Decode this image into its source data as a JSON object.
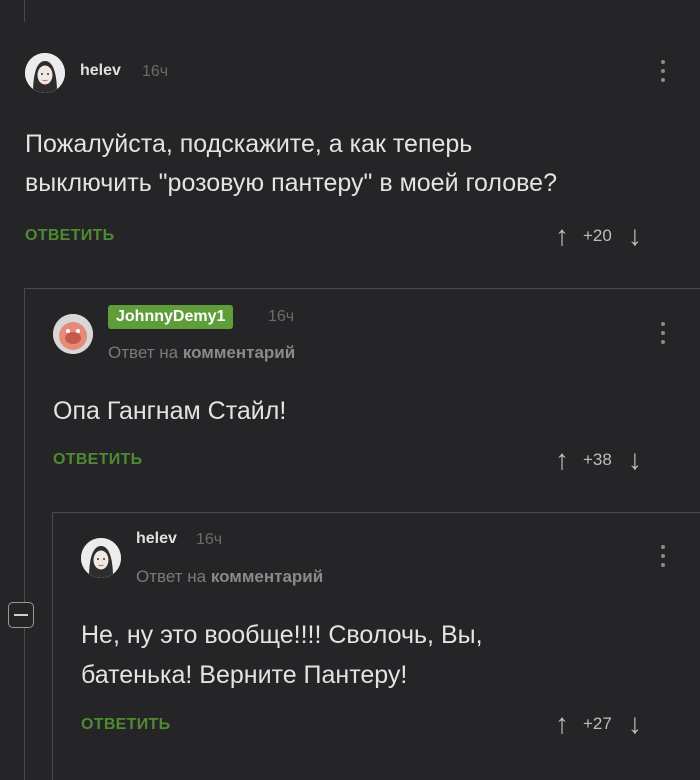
{
  "comments": [
    {
      "author": "helev",
      "time": "16ч",
      "text_lines": [
        "Пожалуйста, подскажите, а как теперь",
        "выключить \"розовую пантеру\" в моей голове?"
      ],
      "reply_label": "ОТВЕТИТЬ",
      "score": "+20"
    },
    {
      "author": "JohnnyDemy1",
      "time": "16ч",
      "reply_prefix": "Ответ на",
      "reply_target": "комментарий",
      "text_lines": [
        "Опа Гангнам Стайл!"
      ],
      "reply_label": "ОТВЕТИТЬ",
      "score": "+38"
    },
    {
      "author": "helev",
      "time": "16ч",
      "reply_prefix": "Ответ на",
      "reply_target": "комментарий",
      "text_lines": [
        "Не, ну это вообще!!!! Сволочь, Вы,",
        "батенька! Верните Пантеру!"
      ],
      "reply_label": "ОТВЕТИТЬ",
      "score": "+27"
    }
  ],
  "icons": {
    "upvote": "↑",
    "downvote": "↓",
    "more": "more-vertical-icon",
    "collapse": "minus-square-icon"
  },
  "colors": {
    "background": "#252527",
    "accent_green": "#5f9d38",
    "reply_green": "#4f8a33"
  }
}
